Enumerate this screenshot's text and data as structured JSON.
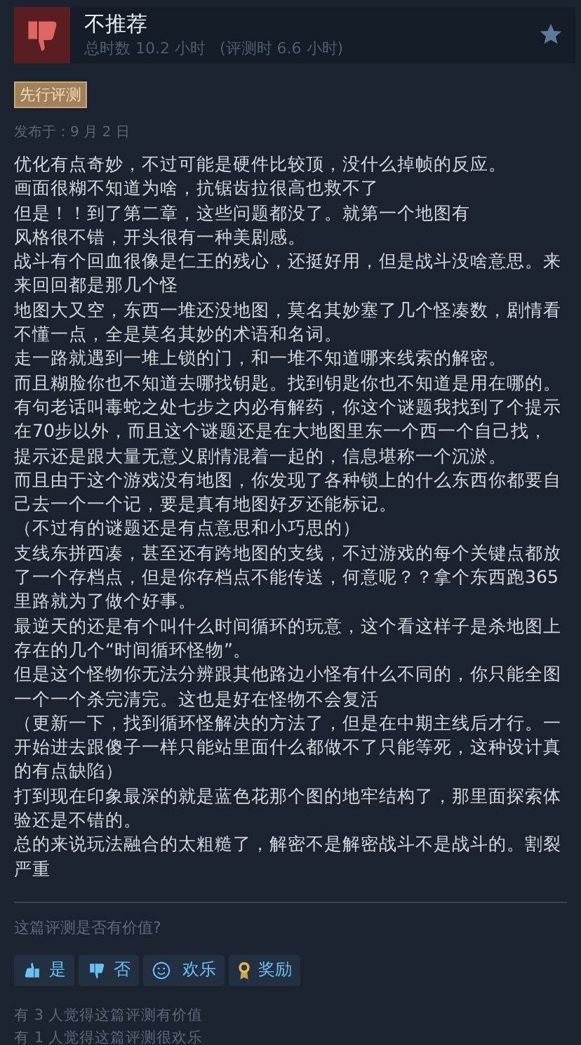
{
  "review": {
    "verdict": "不推荐",
    "recommended": false,
    "hours": "总时数 10.2 小时",
    "hours_at_review": "(评测时 6.6 小时)",
    "badge": "先行评测",
    "posted": "发布于：9 月 2 日",
    "paragraphs": [
      "优化有点奇妙，不过可能是硬件比较顶，没什么掉帧的反应。",
      "画面很糊不知道为啥，抗锯齿拉很高也救不了",
      "但是！！到了第二章，这些问题都没了。就第一个地图有",
      "风格很不错，开头很有一种美剧感。",
      "战斗有个回血很像是仁王的残心，还挺好用，但是战斗没啥意思。来来回回都是那几个怪",
      "地图大又空，东西一堆还没地图，莫名其妙塞了几个怪凑数，剧情看不懂一点，全是莫名其妙的术语和名词。",
      "走一路就遇到一堆上锁的门，和一堆不知道哪来线索的解密。",
      "而且糊脸你也不知道去哪找钥匙。找到钥匙你也不知道是用在哪的。",
      "有句老话叫毒蛇之处七步之内必有解药，你这个谜题我找到了个提示在70步以外，而且这个谜题还是在大地图里东一个西一个自己找，",
      "提示还是跟大量无意义剧情混着一起的，信息堪称一个沉淤。",
      "而且由于这个游戏没有地图，你发现了各种锁上的什么东西你都要自己去一个一个记，要是真有地图好歹还能标记。",
      "（不过有的谜题还是有点意思和小巧思的）",
      "支线东拼西凑，甚至还有跨地图的支线，不过游戏的每个关键点都放了一个存档点，但是你存档点不能传送，何意呢？？拿个东西跑365里路就为了做个好事。",
      "最逆天的还是有个叫什么时间循环的玩意，这个看这样子是杀地图上存在的几个“时间循环怪物”。",
      "但是这个怪物你无法分辨跟其他路边小怪有什么不同的，你只能全图一个一个杀完清完。这也是好在怪物不会复活",
      "（更新一下，找到循环怪解决的方法了，但是在中期主线后才行。一开始进去跟傻子一样只能站里面什么都做不了只能等死，这种设计真的有点缺陷）",
      "打到现在印象最深的就是蓝色花那个图的地牢结构了，那里面探索体验还是不错的。",
      "总的来说玩法融合的太粗糙了，解密不是解密战斗不是战斗的。割裂严重"
    ]
  },
  "feedback": {
    "question": "这篇评测是否有价值?",
    "buttons": [
      {
        "kind": "thumb-up",
        "label": "是"
      },
      {
        "kind": "thumb-down",
        "label": "否"
      },
      {
        "kind": "smile",
        "label": "欢乐"
      },
      {
        "kind": "award",
        "label": "奖励"
      }
    ],
    "counts": [
      "有 3 人觉得这篇评测有价值",
      "有 1 人觉得这篇评测很欢乐"
    ]
  }
}
